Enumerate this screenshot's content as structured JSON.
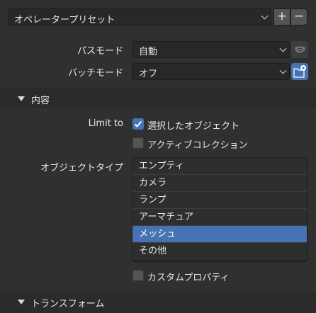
{
  "preset": {
    "label": "オペレータープリセット",
    "add": "+",
    "remove": "−"
  },
  "path_mode": {
    "label": "パスモード",
    "value": "自動"
  },
  "batch_mode": {
    "label": "バッチモード",
    "value": "オフ"
  },
  "include_section": {
    "title": "内容"
  },
  "limit_to": {
    "label": "Limit to",
    "selected_only": {
      "label": "選択したオブジェクト",
      "checked": true
    },
    "active_collection": {
      "label": "アクティブコレクション",
      "checked": false
    }
  },
  "object_types": {
    "label": "オブジェクトタイプ",
    "items": [
      {
        "label": "エンプティ",
        "selected": false
      },
      {
        "label": "カメラ",
        "selected": false
      },
      {
        "label": "ランプ",
        "selected": false
      },
      {
        "label": "アーマチュア",
        "selected": false
      },
      {
        "label": "メッシュ",
        "selected": true
      },
      {
        "label": "その他",
        "selected": false
      }
    ]
  },
  "custom_properties": {
    "label": "カスタムプロパティ",
    "checked": false
  },
  "transform_section": {
    "title": "トランスフォーム"
  },
  "colors": {
    "accent": "#4772b3",
    "bg": "#303030",
    "field": "#282828"
  }
}
